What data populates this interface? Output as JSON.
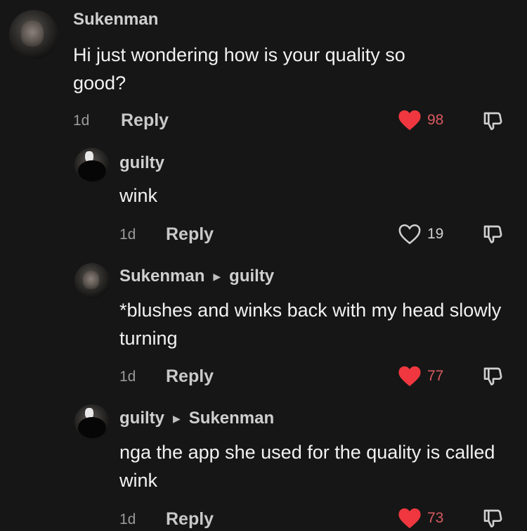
{
  "comments": [
    {
      "username": "Sukenman",
      "reply_to": "",
      "text": "Hi just wondering how is your quality so good?",
      "time": "1d",
      "reply_label": "Reply",
      "likes": "98",
      "liked": true,
      "avatar": "profile-photo-man"
    },
    {
      "username": "guilty",
      "reply_to": "",
      "text": "wink",
      "time": "1d",
      "reply_label": "Reply",
      "likes": "19",
      "liked": false,
      "avatar": "profile-photo-dark"
    },
    {
      "username": "Sukenman",
      "reply_to": "guilty",
      "text": "*blushes and winks back with my head slowly turning",
      "time": "1d",
      "reply_label": "Reply",
      "likes": "77",
      "liked": true,
      "avatar": "profile-photo-man"
    },
    {
      "username": "guilty",
      "reply_to": "Sukenman",
      "text": "nga the app she used for the quality is called wink",
      "time": "1d",
      "reply_label": "Reply",
      "likes": "73",
      "liked": true,
      "avatar": "profile-photo-dark"
    }
  ],
  "colors": {
    "background": "#161616",
    "like_active": "#f0373f",
    "text": "#f2f2f2",
    "muted": "#9a9a9a"
  }
}
